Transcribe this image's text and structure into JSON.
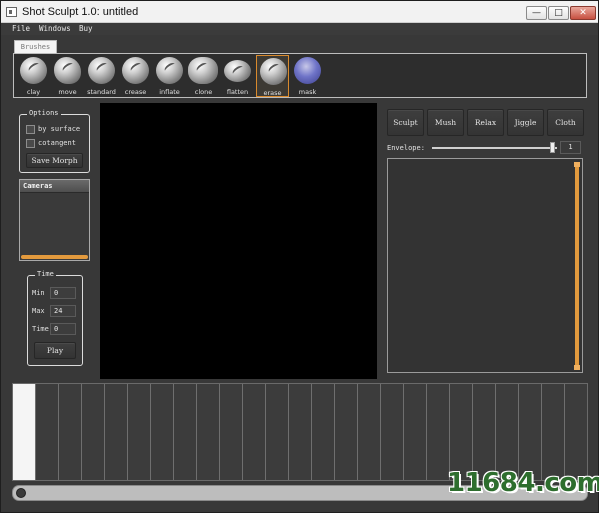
{
  "window": {
    "title": "Shot Sculpt 1.0: untitled",
    "controls": {
      "minimize": "—",
      "maximize": "□",
      "close": "✕"
    }
  },
  "menu": [
    "File",
    "Windows",
    "Buy"
  ],
  "brushes_tab": "Brushes",
  "brushes": [
    {
      "label": "clay"
    },
    {
      "label": "move"
    },
    {
      "label": "standard"
    },
    {
      "label": "crease"
    },
    {
      "label": "inflate"
    },
    {
      "label": "clone"
    },
    {
      "label": "flatten"
    },
    {
      "label": "erase",
      "selected": true
    },
    {
      "label": "mask"
    }
  ],
  "options": {
    "title": "Options",
    "by_surface": {
      "label": "by surface",
      "checked": false
    },
    "cotangent": {
      "label": "cotangent",
      "checked": false
    },
    "save_morph": "Save Morph"
  },
  "cameras": {
    "title": "Cameras"
  },
  "time": {
    "title": "Time",
    "min": {
      "label": "Min",
      "value": "0"
    },
    "max": {
      "label": "Max",
      "value": "24"
    },
    "time": {
      "label": "Time",
      "value": "0"
    },
    "play": "Play"
  },
  "right_tools": [
    "Sculpt",
    "Mush",
    "Relax",
    "Jiggle",
    "Cloth"
  ],
  "envelope": {
    "label": "Envelope:",
    "value": "1",
    "level": 1.0
  },
  "watermark": "11684.com",
  "colors": {
    "accent": "#e39a3d",
    "panel": "#383838",
    "viewport": "#000000",
    "watermark": "#2e6e2e"
  }
}
